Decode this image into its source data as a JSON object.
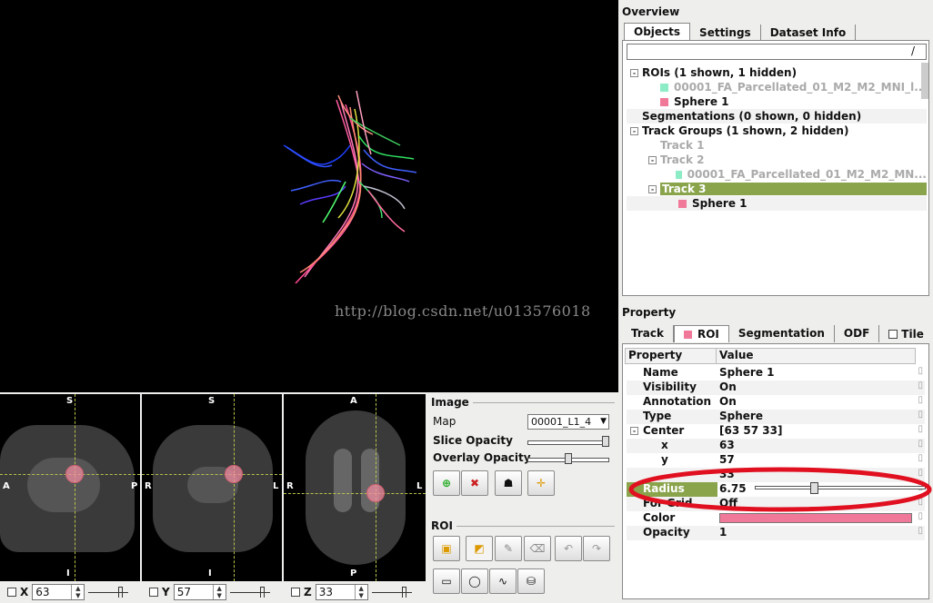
{
  "viewport": {
    "watermark": "http://blog.csdn.net/u013576018"
  },
  "slices": [
    {
      "top": "S",
      "bottom": "I",
      "left": "A",
      "right": "P",
      "axis": "X",
      "value": "63"
    },
    {
      "top": "S",
      "bottom": "I",
      "left": "R",
      "right": "L",
      "axis": "Y",
      "value": "57"
    },
    {
      "top": "A",
      "bottom": "P",
      "left": "R",
      "right": "L",
      "axis": "Z",
      "value": "33"
    }
  ],
  "image_panel": {
    "title": "Image",
    "map_label": "Map",
    "map_value": "00001_L1_4",
    "slice_opacity_label": "Slice Opacity",
    "overlay_opacity_label": "Overlay Opacity",
    "slice_opacity": 1.0,
    "overlay_opacity": 0.5
  },
  "roi_panel": {
    "title": "ROI"
  },
  "overview": {
    "title": "Overview",
    "tabs": [
      "Objects",
      "Settings",
      "Dataset Info"
    ],
    "filter_text": "/",
    "tree": [
      {
        "label": "ROIs (1 shown, 1 hidden)",
        "level": 0,
        "expander": "-",
        "state": "normal"
      },
      {
        "label": "00001_FA_Parcellated_01_M2_M2_MNI_l...",
        "level": 1,
        "swatch": "#40e0a0",
        "state": "dim"
      },
      {
        "label": "Sphere 1",
        "level": 1,
        "swatch": "#f07898",
        "state": "normal"
      },
      {
        "label": "Segmentations (0 shown, 0 hidden)",
        "level": 0,
        "state": "normal"
      },
      {
        "label": "Track Groups (1 shown, 2 hidden)",
        "level": 0,
        "expander": "-",
        "state": "normal"
      },
      {
        "label": "Track 1",
        "level": 1,
        "state": "dim"
      },
      {
        "label": "Track 2",
        "level": 1,
        "expander": "-",
        "state": "dim"
      },
      {
        "label": "00001_FA_Parcellated_01_M2_M2_MN...",
        "level": 2,
        "swatch": "#40e0a0",
        "state": "dim"
      },
      {
        "label": "Track 3",
        "level": 1,
        "expander": "-",
        "state": "selected"
      },
      {
        "label": "Sphere 1",
        "level": 2,
        "swatch": "#f07898",
        "state": "normal"
      }
    ]
  },
  "property": {
    "title": "Property",
    "tabs": [
      "Track",
      "ROI",
      "Segmentation",
      "ODF",
      "Tile"
    ],
    "col_property": "Property",
    "col_value": "Value",
    "rows": [
      {
        "key": "Name",
        "value": "Sphere 1",
        "indent": 0
      },
      {
        "key": "Visibility",
        "value": "On",
        "indent": 0
      },
      {
        "key": "Annotation",
        "value": "On",
        "indent": 0
      },
      {
        "key": "Type",
        "value": "Sphere",
        "indent": 0
      },
      {
        "key": "Center",
        "value": "[63 57 33]",
        "indent": 0,
        "expander": "-"
      },
      {
        "key": "x",
        "value": "63",
        "indent": 1
      },
      {
        "key": "y",
        "value": "57",
        "indent": 1
      },
      {
        "key": "",
        "value": "33",
        "indent": 1
      },
      {
        "key": "Radius",
        "value": "6.75",
        "indent": 0,
        "highlight": true
      },
      {
        "key": "For Grid",
        "value": "Off",
        "indent": 0
      },
      {
        "key": "Color",
        "value": "",
        "indent": 0,
        "color": "#f07898"
      },
      {
        "key": "Opacity",
        "value": "1",
        "indent": 0
      }
    ],
    "radius_slider": 0.34
  },
  "colors": {
    "selection": "#8aa44c",
    "roi_pink": "#f07898",
    "annotation_red": "#e01020"
  }
}
